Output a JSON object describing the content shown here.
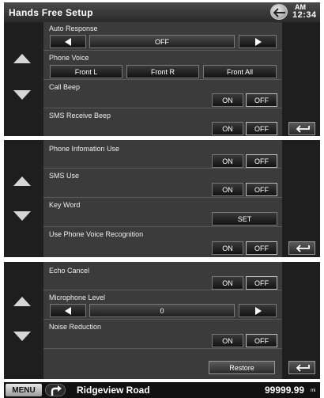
{
  "header": {
    "title": "Hands Free Setup",
    "clock_ampm": "AM",
    "clock_time": "12:34"
  },
  "panel1": {
    "auto_response": {
      "label": "Auto Response",
      "value": "OFF"
    },
    "phone_voice": {
      "label": "Phone Voice",
      "options": [
        "Front L",
        "Front R",
        "Front All"
      ]
    },
    "call_beep": {
      "label": "Call Beep",
      "on": "ON",
      "off": "OFF"
    },
    "sms_receive_beep": {
      "label": "SMS Receive Beep",
      "on": "ON",
      "off": "OFF"
    }
  },
  "panel2": {
    "phone_info_use": {
      "label": "Phone Infomation Use",
      "on": "ON",
      "off": "OFF"
    },
    "sms_use": {
      "label": "SMS Use",
      "on": "ON",
      "off": "OFF"
    },
    "key_word": {
      "label": "Key Word",
      "button": "SET"
    },
    "voice_recognition": {
      "label": "Use Phone Voice Recognition",
      "on": "ON",
      "off": "OFF"
    }
  },
  "panel3": {
    "echo_cancel": {
      "label": "Echo Cancel",
      "on": "ON",
      "off": "OFF"
    },
    "microphone_level": {
      "label": "Microphone Level",
      "value": "0"
    },
    "noise_reduction": {
      "label": "Noise Reduction",
      "on": "ON",
      "off": "OFF"
    },
    "restore_label": "Restore"
  },
  "status_bar": {
    "menu_label": "MENU",
    "road_name": "Ridgeview Road",
    "distance": "99999.99",
    "distance_unit": "mi"
  },
  "icons": {
    "scroll_up": "triangle-up-icon",
    "scroll_down": "triangle-down-icon",
    "return": "return-arrow-icon",
    "back": "back-arrow-icon",
    "direction": "turn-right-icon"
  },
  "colors": {
    "panel_bg": "#3b3b3b",
    "strip_bg": "#1e1e1e",
    "arrow": "#d6d6d6"
  }
}
